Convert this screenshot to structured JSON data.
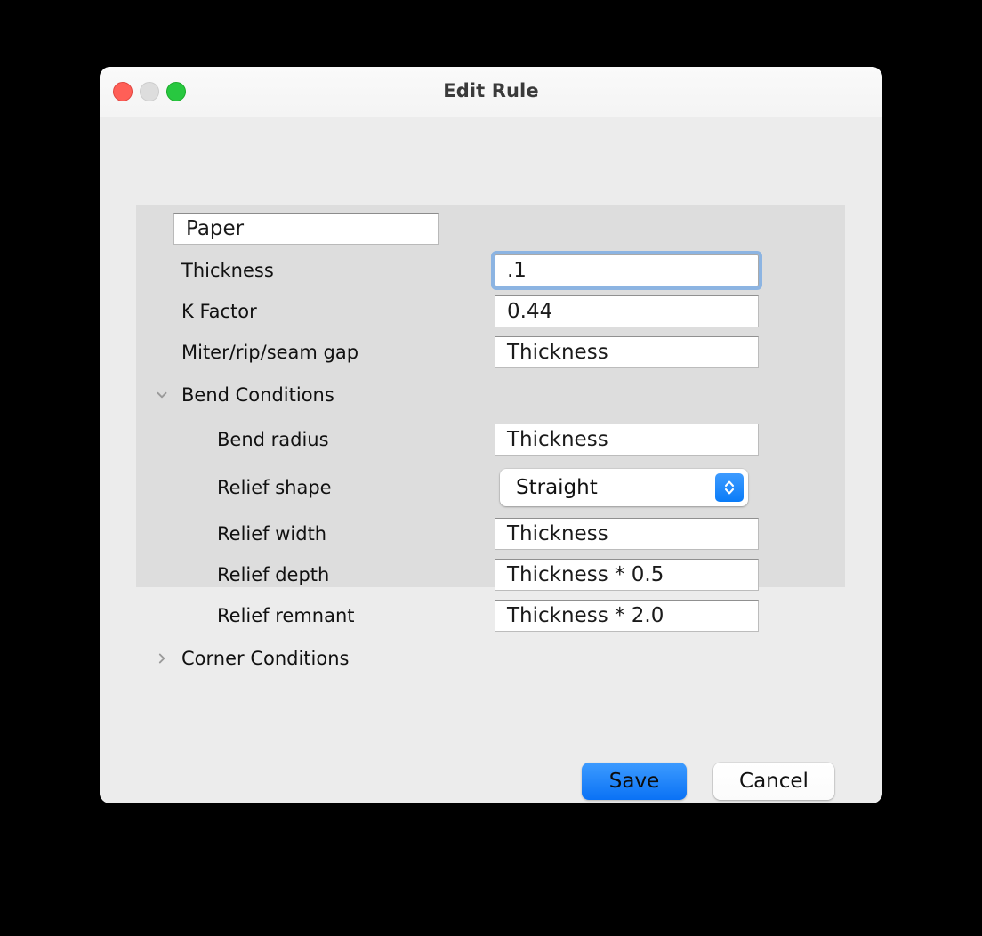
{
  "window": {
    "title": "Edit Rule",
    "traffic_lights": [
      {
        "name": "close",
        "color": "#ff5f57"
      },
      {
        "name": "minimize",
        "color": "#dddddd"
      },
      {
        "name": "zoom",
        "color": "#28c840"
      }
    ]
  },
  "form": {
    "rule_name": "Paper",
    "rows": [
      {
        "label": "Thickness",
        "value": ".1",
        "focused": true
      },
      {
        "label": "K Factor",
        "value": "0.44",
        "focused": false
      },
      {
        "label": "Miter/rip/seam gap",
        "value": "Thickness",
        "focused": false
      }
    ],
    "bend_conditions": {
      "label": "Bend Conditions",
      "expanded": true,
      "chevron": "chevron-down-icon",
      "rows": [
        {
          "label": "Bend radius",
          "value": "Thickness"
        },
        {
          "label": "Relief width",
          "value": "Thickness"
        },
        {
          "label": "Relief depth",
          "value": "Thickness * 0.5"
        },
        {
          "label": "Relief remnant",
          "value": "Thickness * 2.0"
        }
      ],
      "relief_shape": {
        "label": "Relief shape",
        "value": "Straight",
        "options": [
          "Straight"
        ]
      }
    },
    "corner_conditions": {
      "label": "Corner Conditions",
      "expanded": false,
      "chevron": "chevron-right-icon"
    }
  },
  "footer": {
    "save_label": "Save",
    "cancel_label": "Cancel"
  },
  "colors": {
    "accent": "#0a72f5",
    "focus_ring": "#8cb4e2",
    "panel_bg": "#dddddd",
    "window_bg": "#ececec"
  }
}
